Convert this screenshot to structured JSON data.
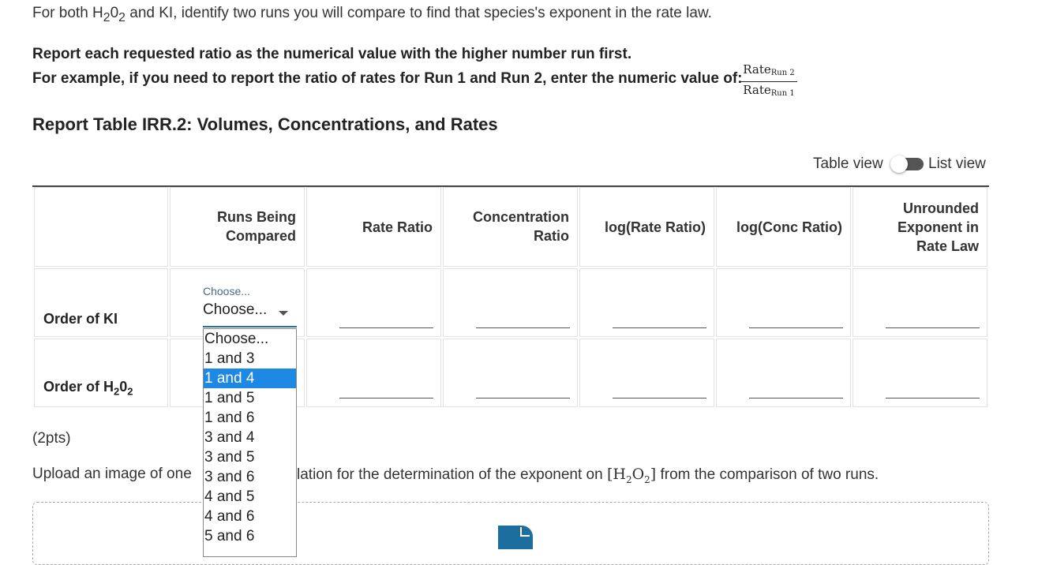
{
  "instructions": {
    "line1_pre": "For both H",
    "line1_sub1": "2",
    "line1_mid": "0",
    "line1_sub2": "2",
    "line1_post": " and KI, identify two runs you will compare to find that species's exponent in the rate law.",
    "line2": "Report each requested ratio as the numerical value with the higher number run first.",
    "line3": "For example, if you need to report the ratio of rates for Run 1 and Run 2, enter the numeric value of:",
    "fraction_num": "Rate",
    "fraction_num_sub": "Run 2",
    "fraction_den": "Rate",
    "fraction_den_sub": "Run 1"
  },
  "table_title": "Report Table IRR.2: Volumes, Concentrations, and Rates",
  "view_toggle": {
    "left_label": "Table view",
    "right_label": "List view"
  },
  "columns": [
    {
      "lines": [
        "Runs Being",
        "Compared"
      ]
    },
    {
      "lines": [
        "Rate Ratio"
      ]
    },
    {
      "lines": [
        "Concentration",
        "Ratio"
      ]
    },
    {
      "lines": [
        "log(Rate Ratio)"
      ]
    },
    {
      "lines": [
        "log(Conc Ratio)"
      ]
    },
    {
      "lines": [
        "Unrounded",
        "Exponent in",
        "Rate Law"
      ]
    }
  ],
  "rows": {
    "ki_label": "Order of KI",
    "h2o2_label_pre": "Order of H",
    "h2o2_sub1": "2",
    "h2o2_mid": "0",
    "h2o2_sub2": "2"
  },
  "select": {
    "floating_label": "Choose...",
    "value": "Choose...",
    "options": [
      "Choose...",
      "1 and 3",
      "1 and 4",
      "1 and 5",
      "1 and 6",
      "3 and 4",
      "3 and 5",
      "3 and 6",
      "4 and 5",
      "4 and 6",
      "5 and 6"
    ],
    "highlighted": "1 and 4"
  },
  "points": "(2pts)",
  "upload": {
    "text_left": "Upload an image of one",
    "text_right_pre": "lation for the determination of the exponent on ",
    "math_H": "H",
    "math_sub1": "2",
    "math_O": "O",
    "math_sub2": "2",
    "text_right_post": " from the comparison of two runs."
  },
  "colors": {
    "accent": "#1e88e5",
    "underline": "#1e6fb0",
    "upload_icon": "#1c6e9e"
  },
  "icons": {
    "caret": "chevron-down-icon",
    "upload": "file-upload-icon"
  }
}
